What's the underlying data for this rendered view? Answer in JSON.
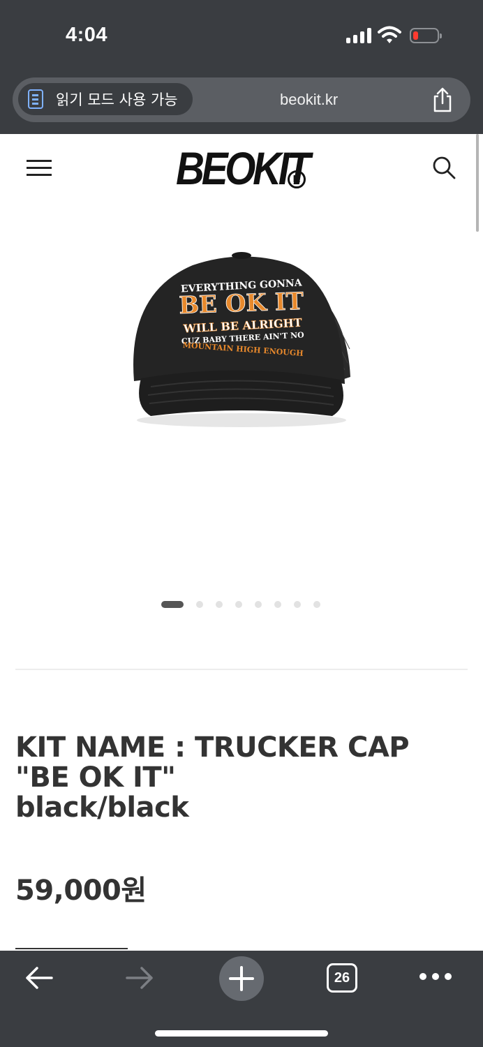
{
  "status_bar": {
    "time": "4:04"
  },
  "browser": {
    "reader_mode_label": "읽기 모드 사용 가능",
    "url": "beokit.kr",
    "tab_count": "26"
  },
  "site": {
    "logo": "BEOKIT",
    "logo_mark": "R"
  },
  "product": {
    "image_alt": "TRUCKER CAP BE OK IT black",
    "cap_print": {
      "line1": "EVERYTHING GONNA",
      "line2": "BE OK IT",
      "line3": "WILL BE ALRIGHT",
      "line4": "CUZ BABY THERE AIN'T NO",
      "line5": "MOUNTAIN HIGH ENOUGH"
    },
    "carousel": {
      "total": 8,
      "active": 1
    },
    "title_lines": [
      "KIT NAME : TRUCKER CAP",
      "\"BE OK IT\"",
      "black/black"
    ],
    "price": "59,000원"
  },
  "colors": {
    "chrome": "#3a3d41",
    "urlbar": "#5b5e63",
    "accent_orange": "#e8892c",
    "text": "#333333"
  },
  "icons": {
    "menu": "hamburger-icon",
    "search": "search-icon",
    "share": "share-icon",
    "reader": "reader-mode-icon",
    "back": "arrow-left-icon",
    "forward": "arrow-right-icon",
    "new_tab": "plus-icon",
    "tabs": "tabs-icon",
    "more": "more-icon"
  }
}
